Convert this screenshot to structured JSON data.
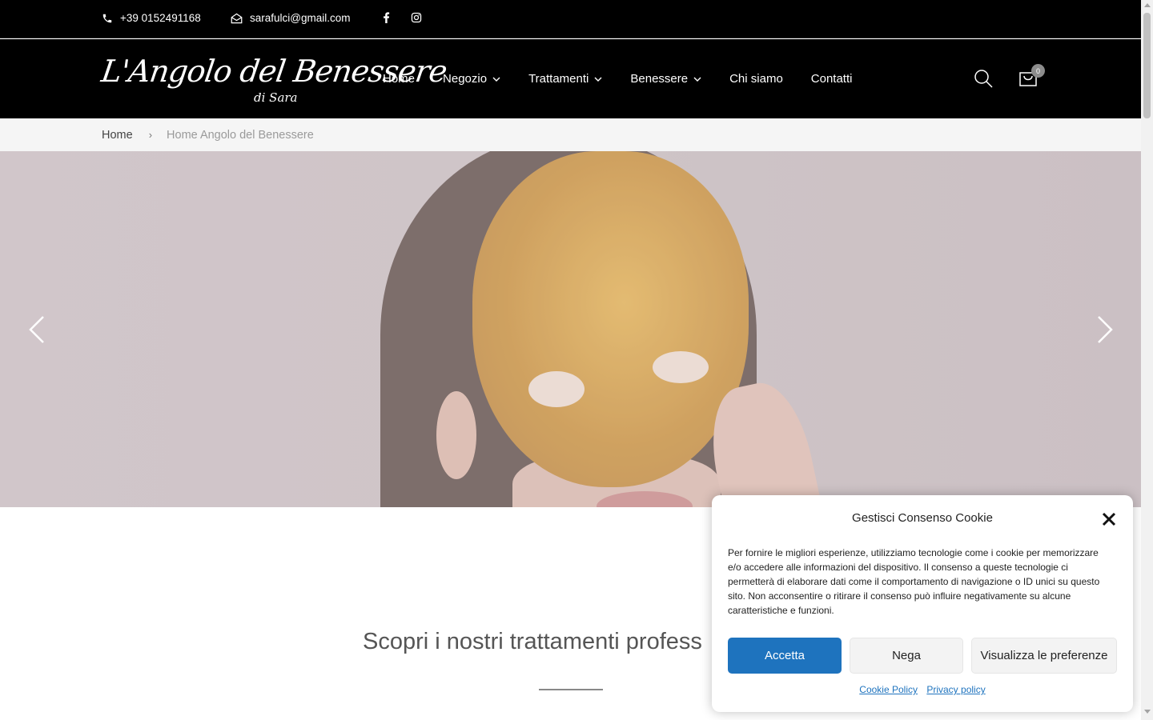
{
  "topbar": {
    "phone": "+39 0152491168",
    "email": "sarafulci@gmail.com",
    "social": [
      "facebook-icon",
      "instagram-icon"
    ]
  },
  "header": {
    "logo_text": "L'Angolo del Benessere",
    "logo_sub": "di Sara",
    "nav": [
      {
        "label": "Home",
        "has_dropdown": false
      },
      {
        "label": "Negozio",
        "has_dropdown": true
      },
      {
        "label": "Trattamenti",
        "has_dropdown": true
      },
      {
        "label": "Benessere",
        "has_dropdown": true
      },
      {
        "label": "Chi siamo",
        "has_dropdown": false
      },
      {
        "label": "Contatti",
        "has_dropdown": false
      }
    ],
    "cart_count": "0"
  },
  "breadcrumb": {
    "home": "Home",
    "separator": "›",
    "current": "Home Angolo del Benessere"
  },
  "hero": {
    "prev": "chevron-left-icon",
    "next": "chevron-right-icon"
  },
  "section": {
    "title": "Scopri i nostri trattamenti profess"
  },
  "cookie": {
    "title": "Gestisci Consenso Cookie",
    "body": "Per fornire le migliori esperienze, utilizziamo tecnologie come i cookie per memorizzare e/o accedere alle informazioni del dispositivo. Il consenso a queste tecnologie ci permetterà di elaborare dati come il comportamento di navigazione o ID unici su questo sito. Non acconsentire o ritirare il consenso può influire negativamente su alcune caratteristiche e funzioni.",
    "accept_label": "Accetta",
    "deny_label": "Nega",
    "prefs_label": "Visualizza le preferenze",
    "cookie_policy_label": "Cookie Policy",
    "privacy_policy_label": "Privacy policy"
  },
  "colors": {
    "header_bg": "#000000",
    "accent_blue": "#1e73be",
    "breadcrumb_bg": "#f5f5f5"
  }
}
